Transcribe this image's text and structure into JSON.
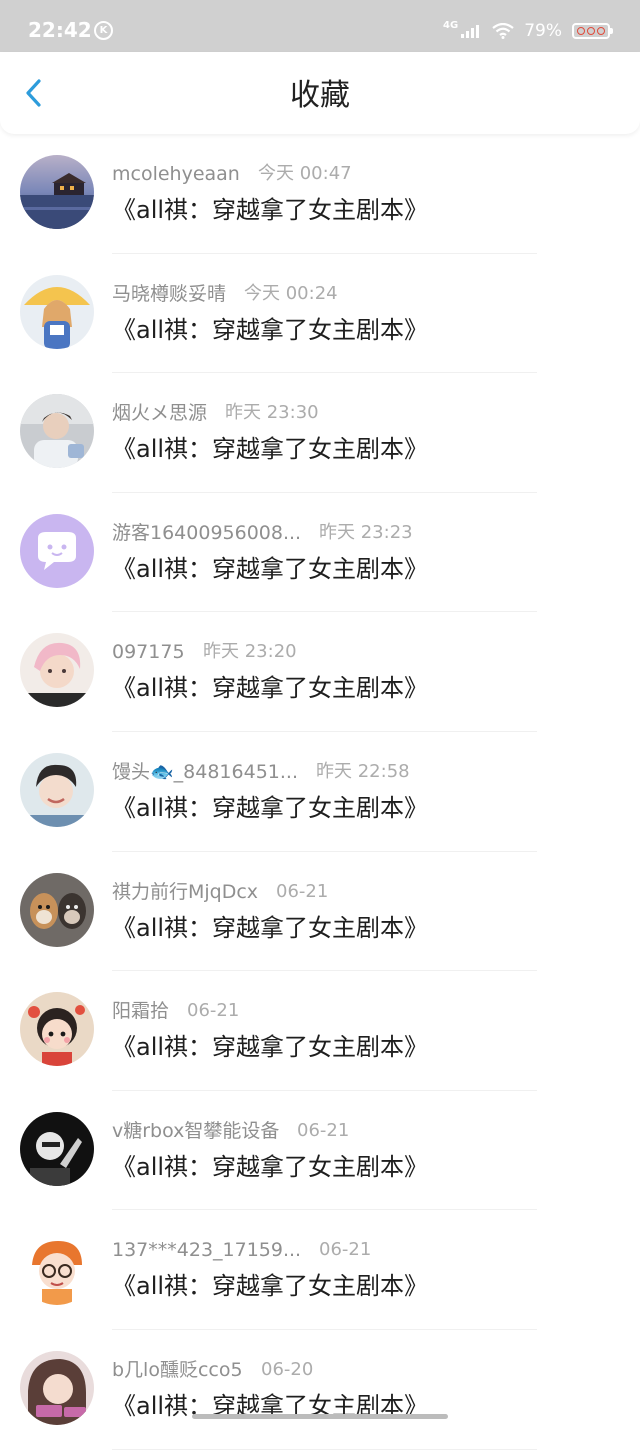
{
  "status_bar": {
    "time": "22:42",
    "k_badge": "K",
    "network": "4G",
    "battery_percent": "79%",
    "icons": [
      "k-circle-icon",
      "signal-icon",
      "wifi-icon",
      "battery-icon"
    ]
  },
  "header": {
    "back_icon": "chevron-left-icon",
    "title": "收藏",
    "accent": "#2d9cdb"
  },
  "items": [
    {
      "user": "mcolehyeaan",
      "time": "今天 00:47",
      "title": "《all祺：穿越拿了女主剧本》",
      "avatar": "sunset-lake"
    },
    {
      "user": "马晓樽赕妥晴",
      "time": "今天 00:24",
      "title": "《all祺：穿越拿了女主剧本》",
      "avatar": "anime-umbrella-girl"
    },
    {
      "user": "烟火メ思源",
      "time": "昨天 23:30",
      "title": "《all祺：穿越拿了女主剧本》",
      "avatar": "boy-photo"
    },
    {
      "user": "游客16400956008...",
      "time": "昨天 23:23",
      "title": "《all祺：穿越拿了女主剧本》",
      "avatar": "default-chat-bubble"
    },
    {
      "user": "097175",
      "time": "昨天 23:20",
      "title": "《all祺：穿越拿了女主剧本》",
      "avatar": "pink-hair-portrait"
    },
    {
      "user": "馒头🐟_84816451...",
      "time": "昨天 22:58",
      "title": "《all祺：穿越拿了女主剧本》",
      "avatar": "boy-smiling"
    },
    {
      "user": "祺力前行MjqDcx",
      "time": "06-21",
      "title": "《all祺：穿越拿了女主剧本》",
      "avatar": "two-dogs"
    },
    {
      "user": "阳霜拾",
      "time": "06-21",
      "title": "《all祺：穿越拿了女主剧本》",
      "avatar": "cartoon-girl"
    },
    {
      "user": "v糖rbox智攀能设备",
      "time": "06-21",
      "title": "《all祺：穿越拿了女主剧本》",
      "avatar": "monochrome-hand"
    },
    {
      "user": "137***423_17159...",
      "time": "06-21",
      "title": "《all祺：穿越拿了女主剧本》",
      "avatar": "cartoon-glasses-kid"
    },
    {
      "user": "b几lo醺贬cco5",
      "time": "06-20",
      "title": "《all祺：穿越拿了女主剧本》",
      "avatar": "girl-portrait"
    }
  ]
}
